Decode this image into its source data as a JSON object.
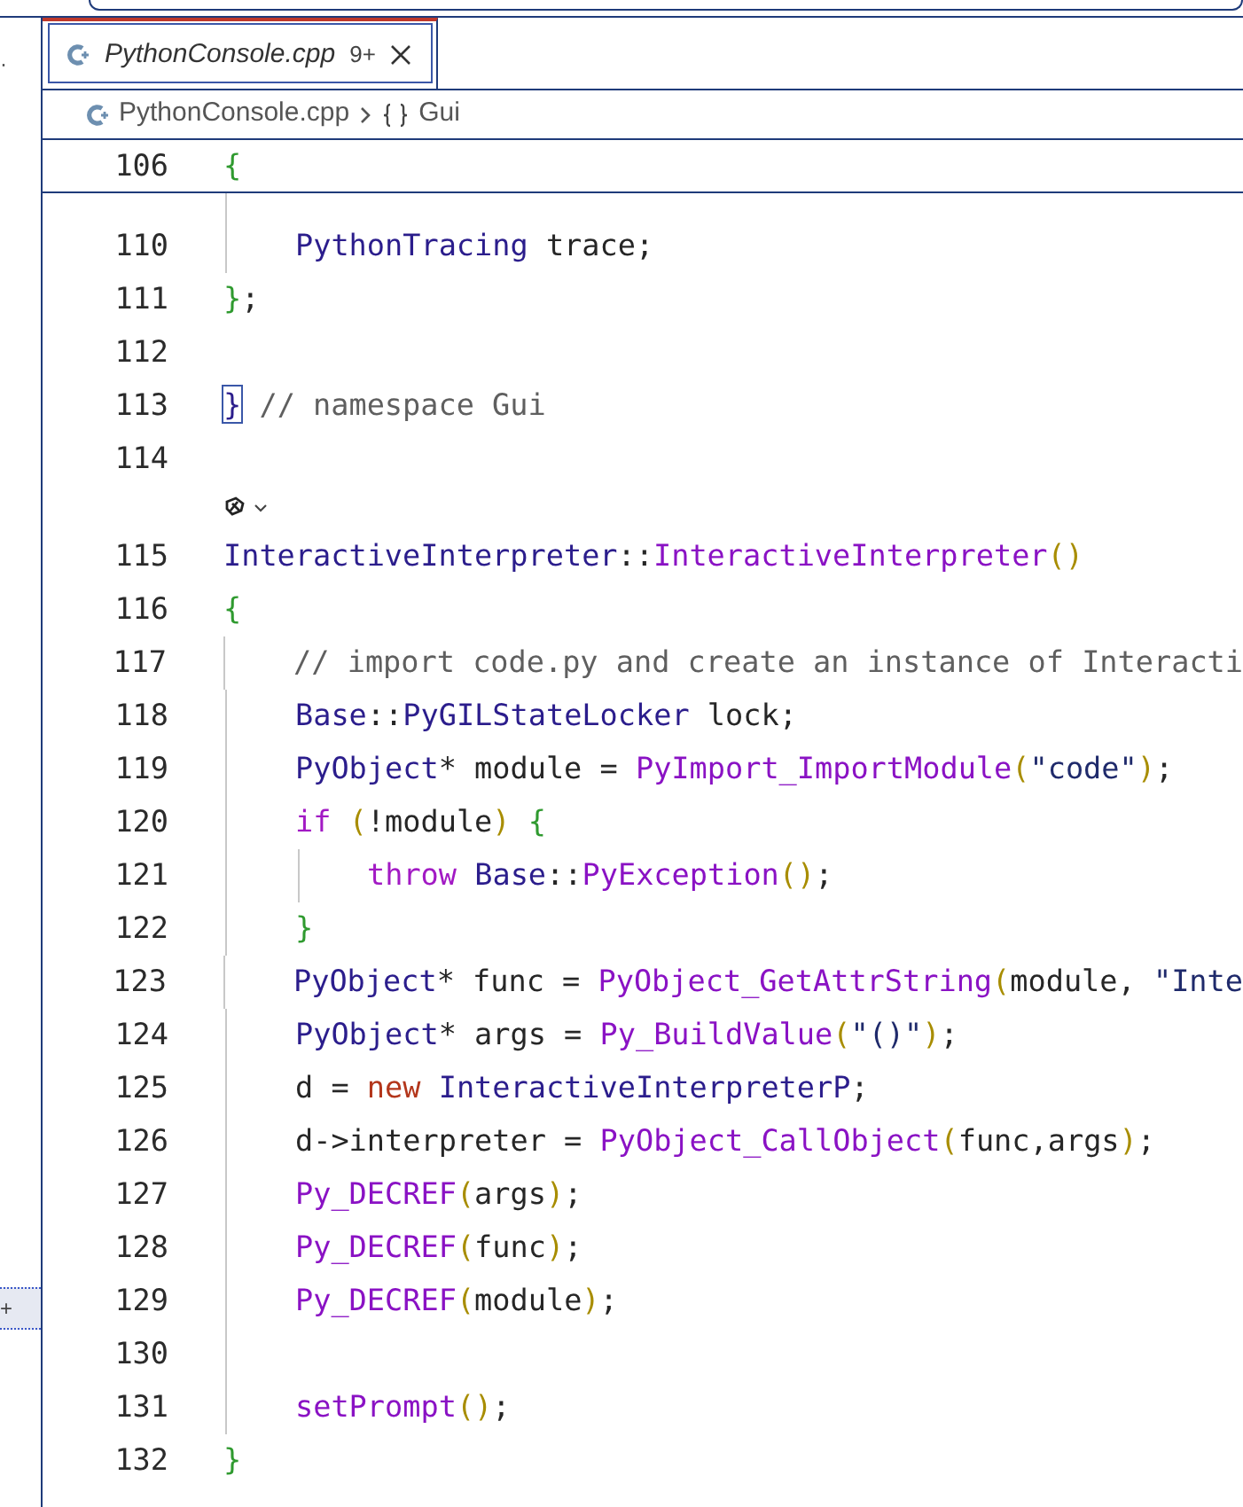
{
  "sidebar": {
    "items": [
      {
        "text": "·",
        "selected": false
      },
      {
        "text": "+",
        "selected": true
      }
    ]
  },
  "tabs": [
    {
      "label": "PythonConsole.cpp",
      "badge": "9+",
      "selected": true
    }
  ],
  "breadcrumb": {
    "file": "PythonConsole.cpp",
    "symbol": "Gui"
  },
  "sticky_line": {
    "number": "106",
    "tokens": [
      {
        "text": "{",
        "kind": "brace"
      }
    ],
    "children": [
      {
        "kind": "code",
        "number": "110",
        "tokens": [
          {
            "text": "PythonTracing",
            "kind": "type"
          },
          {
            "text": " trace;",
            "kind": "plain"
          }
        ]
      }
    ]
  },
  "lines": [
    {
      "kind": "code",
      "number": "111",
      "tokens": [
        {
          "text": "}",
          "kind": "brace"
        },
        {
          "text": ";",
          "kind": "plain"
        }
      ]
    },
    {
      "kind": "code",
      "number": "112"
    },
    {
      "kind": "code",
      "number": "113",
      "tokens": [
        {
          "text": "}",
          "kind": "match"
        },
        {
          "text": " // namespace Gui",
          "kind": "comment"
        }
      ]
    },
    {
      "kind": "code",
      "number": "114"
    },
    {
      "kind": "codelens"
    },
    {
      "kind": "code",
      "number": "115",
      "tokens": [
        {
          "text": "InteractiveInterpreter",
          "kind": "type"
        },
        {
          "text": "::",
          "kind": "plain"
        },
        {
          "text": "InteractiveInterpreter",
          "kind": "fn"
        },
        {
          "text": "()",
          "kind": "paren"
        }
      ]
    },
    {
      "kind": "code",
      "number": "116",
      "tokens": [
        {
          "text": "{",
          "kind": "brace"
        }
      ],
      "children": [
        {
          "kind": "code",
          "number": "117",
          "tokens": [
            {
              "text": "// import code.py and create an instance of Interacti",
              "kind": "comment"
            }
          ]
        },
        {
          "kind": "code",
          "number": "118",
          "tokens": [
            {
              "text": "Base",
              "kind": "type"
            },
            {
              "text": "::",
              "kind": "plain"
            },
            {
              "text": "PyGILStateLocker",
              "kind": "type"
            },
            {
              "text": " lock;",
              "kind": "plain"
            }
          ]
        },
        {
          "kind": "code",
          "number": "119",
          "tokens": [
            {
              "text": "PyObject",
              "kind": "type"
            },
            {
              "text": "* module = ",
              "kind": "plain"
            },
            {
              "text": "PyImport_ImportModule",
              "kind": "fn"
            },
            {
              "text": "(",
              "kind": "paren"
            },
            {
              "text": "\"code\"",
              "kind": "string"
            },
            {
              "text": ")",
              "kind": "paren"
            },
            {
              "text": ";",
              "kind": "plain"
            }
          ]
        },
        {
          "kind": "code",
          "number": "120",
          "tokens": [
            {
              "text": "if ",
              "kind": "kw"
            },
            {
              "text": "(",
              "kind": "paren"
            },
            {
              "text": "!module",
              "kind": "plain"
            },
            {
              "text": ") ",
              "kind": "paren"
            },
            {
              "text": "{",
              "kind": "brace"
            }
          ],
          "children": [
            {
              "kind": "code",
              "number": "121",
              "tokens": [
                {
                  "text": "throw ",
                  "kind": "kw"
                },
                {
                  "text": "Base",
                  "kind": "type"
                },
                {
                  "text": "::",
                  "kind": "plain"
                },
                {
                  "text": "PyException",
                  "kind": "fn"
                },
                {
                  "text": "()",
                  "kind": "paren"
                },
                {
                  "text": ";",
                  "kind": "plain"
                }
              ]
            }
          ]
        },
        {
          "kind": "code",
          "number": "122",
          "tokens": [
            {
              "text": "}",
              "kind": "brace"
            }
          ]
        },
        {
          "kind": "code",
          "number": "123",
          "tokens": [
            {
              "text": "PyObject",
              "kind": "type"
            },
            {
              "text": "* func = ",
              "kind": "plain"
            },
            {
              "text": "PyObject_GetAttrString",
              "kind": "fn"
            },
            {
              "text": "(",
              "kind": "paren"
            },
            {
              "text": "module, ",
              "kind": "plain"
            },
            {
              "text": "\"Inte",
              "kind": "string"
            }
          ]
        },
        {
          "kind": "code",
          "number": "124",
          "tokens": [
            {
              "text": "PyObject",
              "kind": "type"
            },
            {
              "text": "* args = ",
              "kind": "plain"
            },
            {
              "text": "Py_BuildValue",
              "kind": "fn"
            },
            {
              "text": "(",
              "kind": "paren"
            },
            {
              "text": "\"()\"",
              "kind": "string"
            },
            {
              "text": ")",
              "kind": "paren"
            },
            {
              "text": ";",
              "kind": "plain"
            }
          ]
        },
        {
          "kind": "code",
          "number": "125",
          "tokens": [
            {
              "text": "d = ",
              "kind": "plain"
            },
            {
              "text": "new ",
              "kind": "new"
            },
            {
              "text": "InteractiveInterpreterP",
              "kind": "type"
            },
            {
              "text": ";",
              "kind": "plain"
            }
          ]
        },
        {
          "kind": "code",
          "number": "126",
          "tokens": [
            {
              "text": "d->interpreter = ",
              "kind": "plain"
            },
            {
              "text": "PyObject_CallObject",
              "kind": "fn"
            },
            {
              "text": "(",
              "kind": "paren"
            },
            {
              "text": "func,args",
              "kind": "plain"
            },
            {
              "text": ")",
              "kind": "paren"
            },
            {
              "text": ";",
              "kind": "plain"
            }
          ]
        },
        {
          "kind": "code",
          "number": "127",
          "tokens": [
            {
              "text": "Py_DECREF",
              "kind": "fn"
            },
            {
              "text": "(",
              "kind": "paren"
            },
            {
              "text": "args",
              "kind": "plain"
            },
            {
              "text": ")",
              "kind": "paren"
            },
            {
              "text": ";",
              "kind": "plain"
            }
          ]
        },
        {
          "kind": "code",
          "number": "128",
          "tokens": [
            {
              "text": "Py_DECREF",
              "kind": "fn"
            },
            {
              "text": "(",
              "kind": "paren"
            },
            {
              "text": "func",
              "kind": "plain"
            },
            {
              "text": ")",
              "kind": "paren"
            },
            {
              "text": ";",
              "kind": "plain"
            }
          ]
        },
        {
          "kind": "code",
          "number": "129",
          "tokens": [
            {
              "text": "Py_DECREF",
              "kind": "fn"
            },
            {
              "text": "(",
              "kind": "paren"
            },
            {
              "text": "module",
              "kind": "plain"
            },
            {
              "text": ")",
              "kind": "paren"
            },
            {
              "text": ";",
              "kind": "plain"
            }
          ]
        },
        {
          "kind": "code",
          "number": "130"
        },
        {
          "kind": "code",
          "number": "131",
          "tokens": [
            {
              "text": "setPrompt",
              "kind": "fn"
            },
            {
              "text": "()",
              "kind": "paren"
            },
            {
              "text": ";",
              "kind": "plain"
            }
          ]
        }
      ]
    },
    {
      "kind": "code",
      "number": "132",
      "tokens": [
        {
          "text": "}",
          "kind": "brace"
        }
      ]
    }
  ]
}
